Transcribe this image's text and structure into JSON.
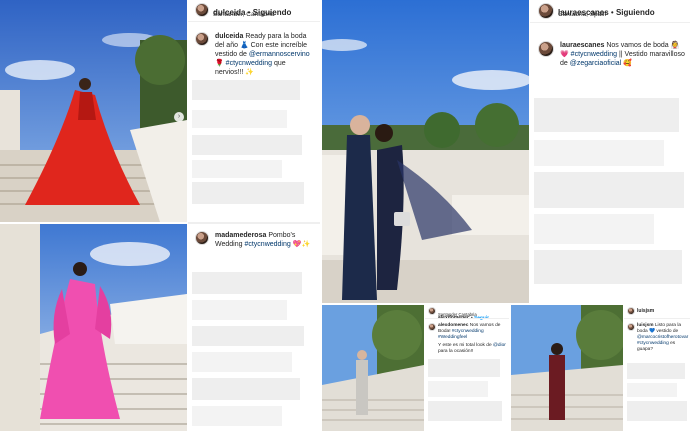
{
  "collage": {
    "post_dulceida": {
      "username": "dulceida",
      "follow_label": "Siguiendo",
      "location": "Santander, Cantabria",
      "caption_user": "dulceida",
      "caption_text": "Ready para la boda del año 👗 Con este increíble vestido de @ermannoscervino 🌹 #ctycnwedding que nervios!!! ✨"
    },
    "post_madamederosa": {
      "caption_user": "madamederosa",
      "caption_text": "Pombo's Wedding #ctycnwedding 💖✨"
    },
    "post_lauraescanes": {
      "username": "lauraescanes",
      "follow_label": "Siguiendo",
      "location": "Cantabria, Spain",
      "caption_user": "lauraescanes",
      "caption_text": "Nos vamos de boda 👰💗 #ctycnwedding || Vestido maravilloso de @zegarciaoficial 🥰"
    },
    "post_alexdomenec": {
      "username": "alexdomenec",
      "follow_label": "Seguir",
      "location": "Santander Cantabria",
      "caption_user": "alexdomenec",
      "caption_text": "Nos vamos de Boda! #ctycnwedding #Weddingfeel",
      "reply_text": "Y este es mi total look de @dior para la ocasión!!"
    },
    "post_luisjsm": {
      "username": "luisjsm",
      "caption_user": "luisjsm",
      "caption_text": "Listo para la boda 💙 vestido de @marcocristofherotovar #ctycnwedding es guapa?"
    },
    "sep": " • ",
    "colors": {
      "instagram_link": "#00376b",
      "sky": "#5a8fd6",
      "red_dress": "#e0261d",
      "pink_dress": "#f04fb0"
    },
    "icons": [
      "carousel-next-icon",
      "avatar-icon"
    ]
  }
}
